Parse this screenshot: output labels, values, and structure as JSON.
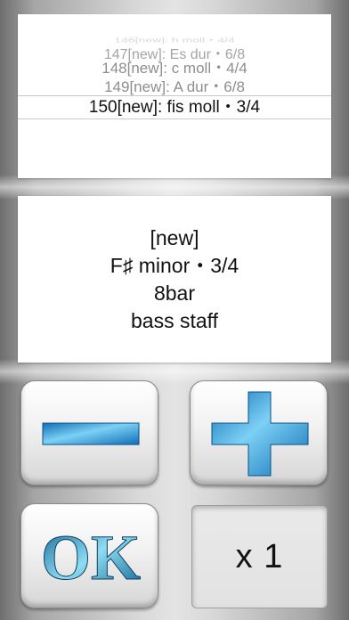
{
  "picker": {
    "rows": [
      "146[new]: h moll・4/4",
      "147[new]: Es dur・6/8",
      "148[new]: c moll・4/4",
      "149[new]: A dur・6/8"
    ],
    "selected": "150[new]: fis moll・3/4"
  },
  "info": {
    "line1": "[new]",
    "line2": "F♯ minor・3/4",
    "line3": "8bar",
    "line4": "bass staff"
  },
  "buttons": {
    "minus_icon": "minus-icon",
    "plus_icon": "plus-icon",
    "ok_label": "OK",
    "multiplier_label": "x 1"
  },
  "colors": {
    "icon_blue": "#1d8fd6",
    "icon_blue_light": "#7cd0f5",
    "panel": "#ffffff"
  }
}
